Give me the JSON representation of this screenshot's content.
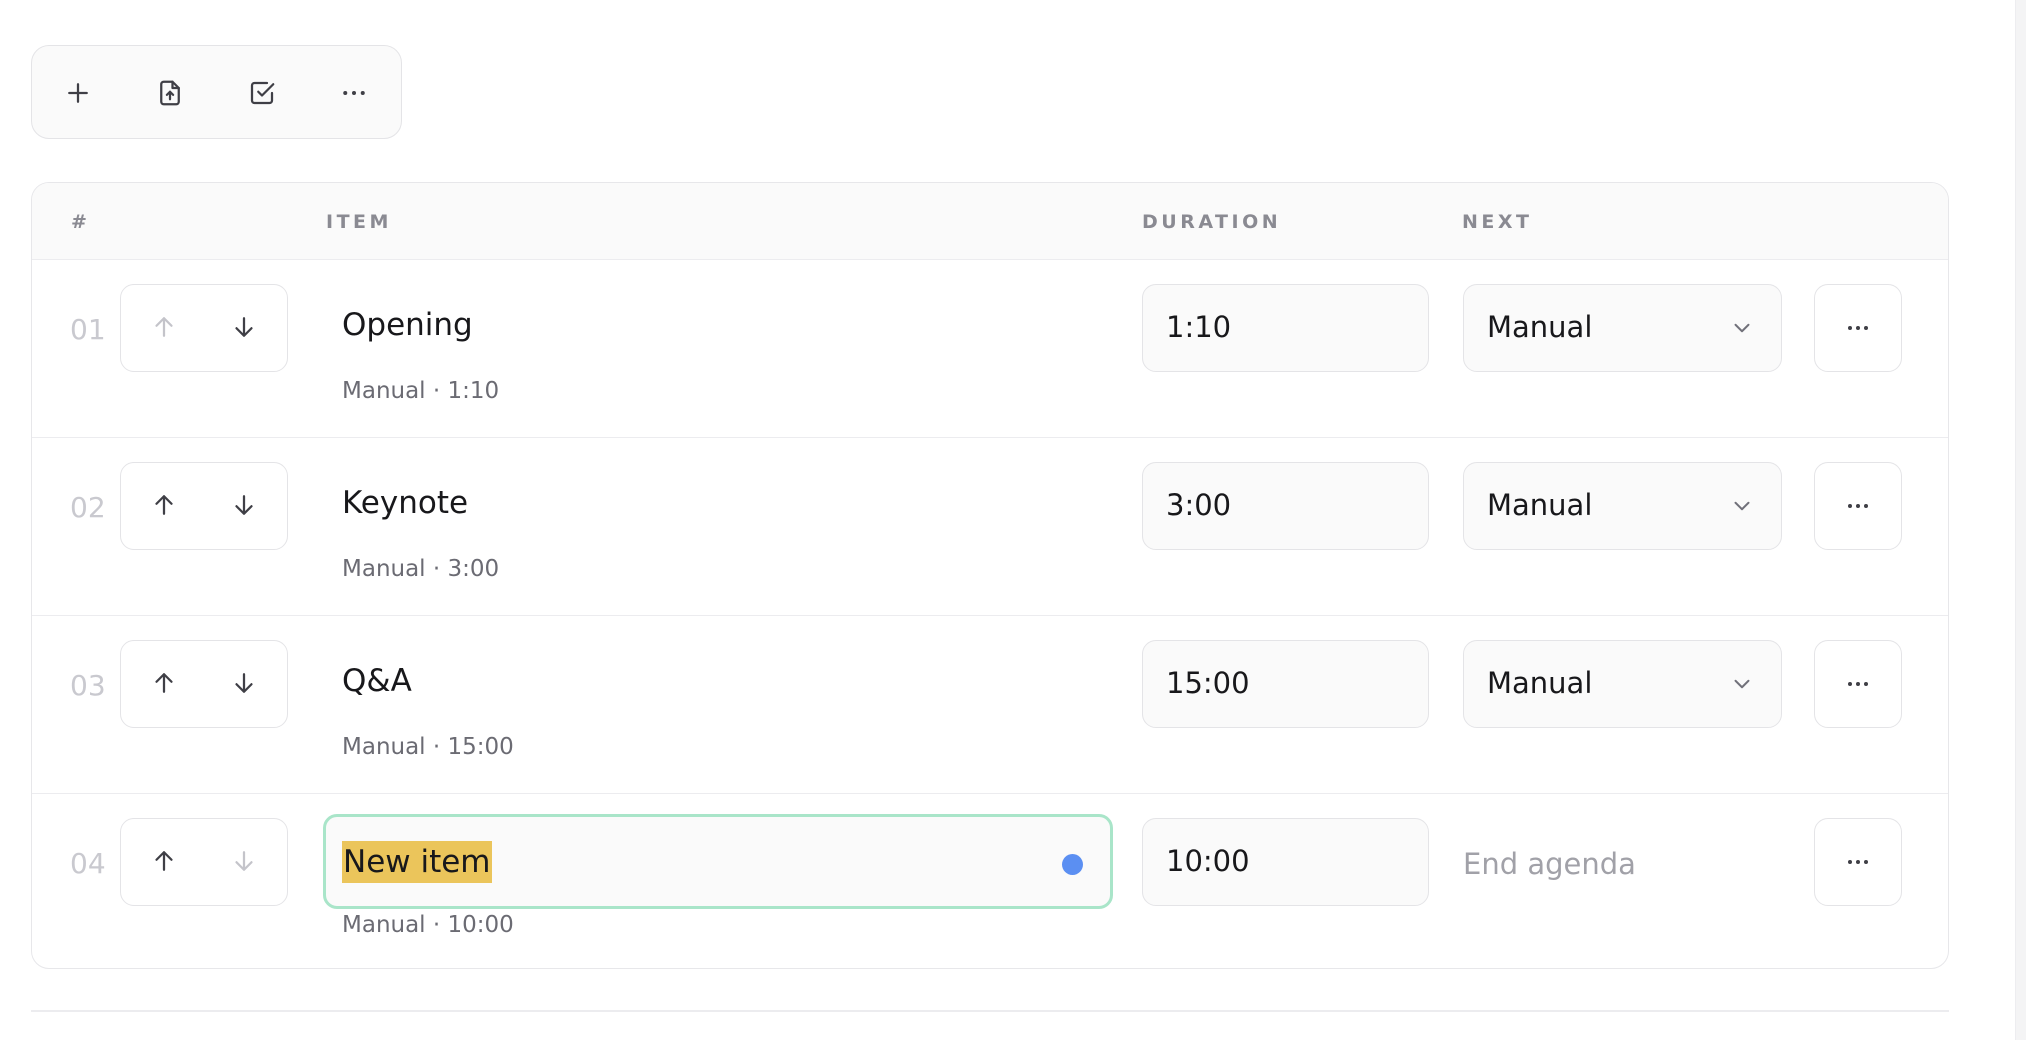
{
  "toolbar": {
    "buttons": [
      {
        "icon": "plus-icon"
      },
      {
        "icon": "file-upload-icon"
      },
      {
        "icon": "checkbox-icon"
      },
      {
        "icon": "more-horizontal-icon"
      }
    ]
  },
  "table": {
    "headers": {
      "num": "#",
      "item": "ITEM",
      "duration": "DURATION",
      "next": "NEXT"
    },
    "rows": [
      {
        "num": "01",
        "title": "Opening",
        "subtitle": "Manual · 1:10",
        "duration": "1:10",
        "next": "Manual",
        "can_move_up": false,
        "can_move_down": true
      },
      {
        "num": "02",
        "title": "Keynote",
        "subtitle": "Manual · 3:00",
        "duration": "3:00",
        "next": "Manual",
        "can_move_up": true,
        "can_move_down": true
      },
      {
        "num": "03",
        "title": "Q&A",
        "subtitle": "Manual · 15:00",
        "duration": "15:00",
        "next": "Manual",
        "can_move_up": true,
        "can_move_down": true
      },
      {
        "num": "04",
        "title": "New item",
        "subtitle": "Manual · 10:00",
        "duration": "10:00",
        "next": "End agenda",
        "can_move_up": true,
        "can_move_down": false
      }
    ]
  },
  "colors": {
    "editor_border": "#a9e5c9",
    "selection": "#ebc55b",
    "unsaved_dot": "#5b8ff2"
  }
}
